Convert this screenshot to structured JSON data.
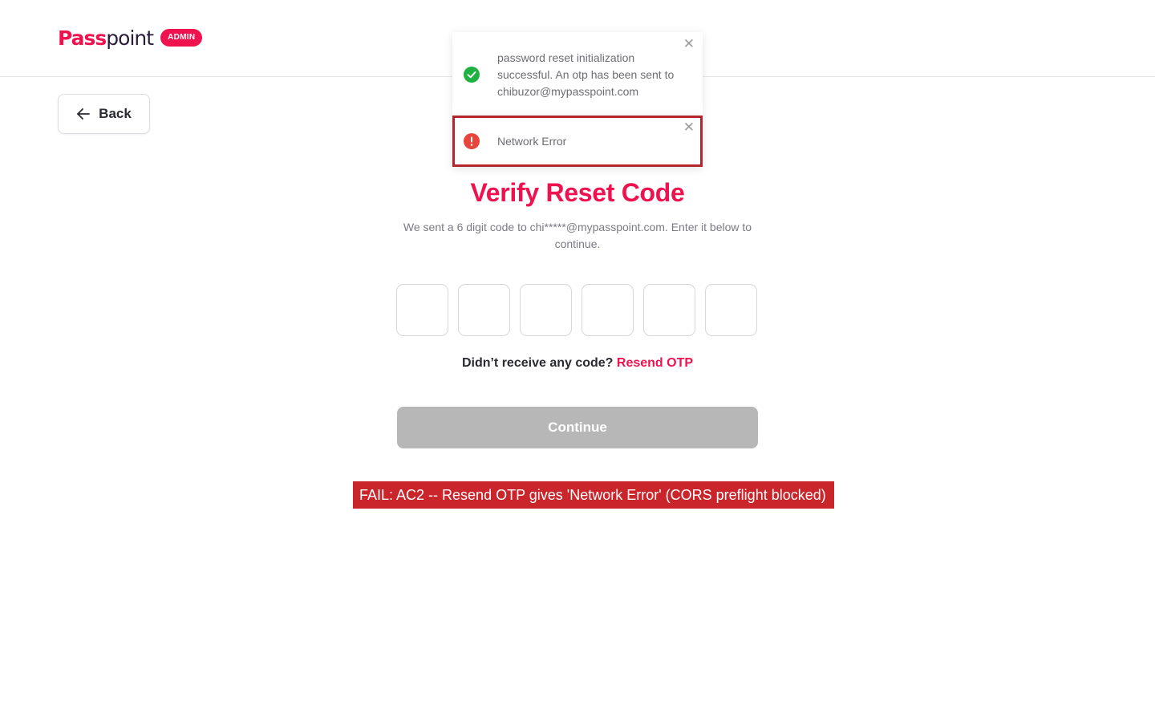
{
  "header": {
    "logo_prefix": "Pass",
    "logo_suffix": "point",
    "badge": "ADMIN"
  },
  "back_button": {
    "label": "Back"
  },
  "page": {
    "title": "Verify Reset Code",
    "subtitle": "We sent a 6 digit code to chi*****@mypasspoint.com. Enter it below to continue.",
    "otp_digits": [
      "",
      "",
      "",
      "",
      "",
      ""
    ],
    "resend_prompt": "Didn’t receive any code?",
    "resend_link": "Resend OTP",
    "continue_label": "Continue"
  },
  "toasts": [
    {
      "type": "success",
      "message": "password reset initialization successful. An otp has been sent to chibuzor@mypasspoint.com",
      "icon": "check-circle-icon",
      "color": "#1fb141"
    },
    {
      "type": "error",
      "message": "Network Error",
      "icon": "exclamation-circle-icon",
      "color": "#e8453c"
    }
  ],
  "annotation": {
    "text": "FAIL: AC2 -- Resend OTP gives 'Network Error' (CORS preflight blocked)",
    "color": "#c9252b"
  },
  "colors": {
    "brand": "#f0114f",
    "disabled": "#b7b7b7"
  }
}
